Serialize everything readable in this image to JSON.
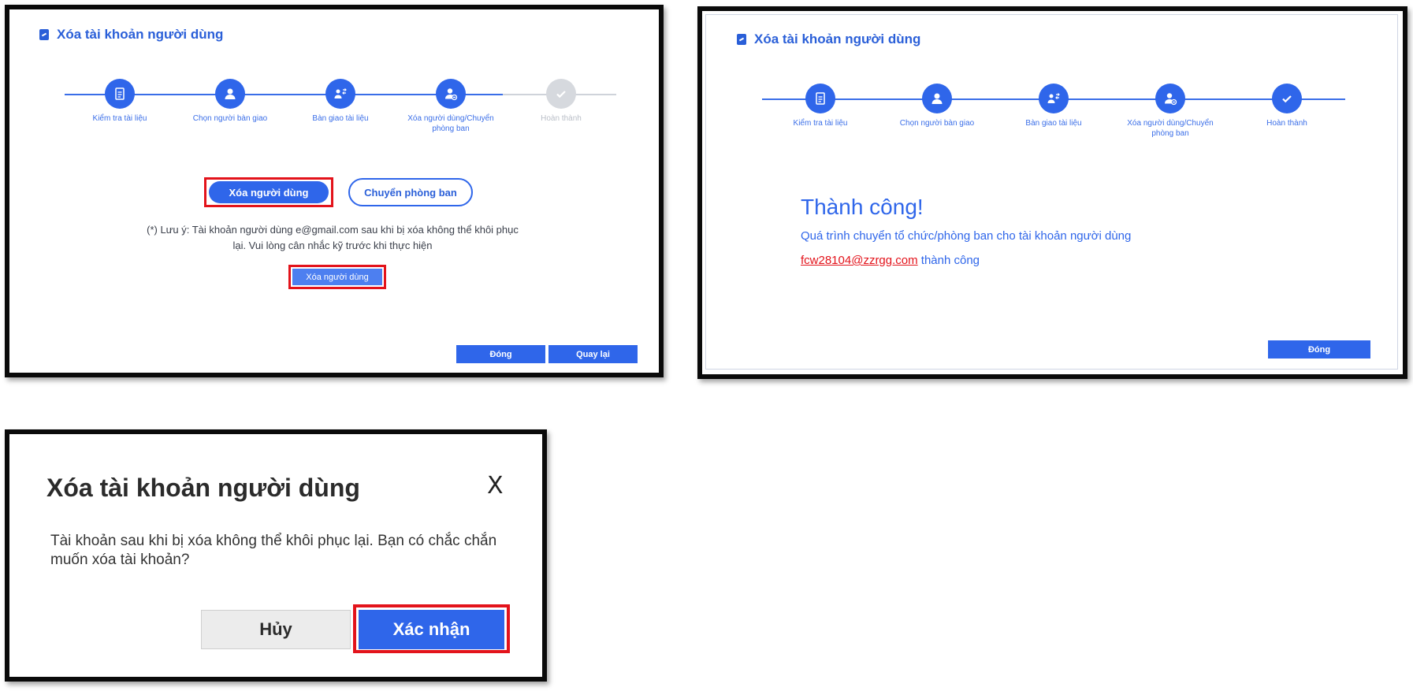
{
  "panel1": {
    "title": "Xóa tài khoản người dùng",
    "steps": [
      {
        "label": "Kiểm tra tài liệu",
        "icon": "document-icon",
        "state": "done"
      },
      {
        "label": "Chọn người bàn giao",
        "icon": "user-icon",
        "state": "done"
      },
      {
        "label": "Bàn giao tài liệu",
        "icon": "users-transfer-icon",
        "state": "done"
      },
      {
        "label": "Xóa người dùng/Chuyển phòng ban",
        "icon": "user-remove-icon",
        "state": "active"
      },
      {
        "label": "Hoàn thành",
        "icon": "check-icon",
        "state": "pending"
      }
    ],
    "delete_user_option": "Xóa người dùng",
    "transfer_department_option": "Chuyển phòng ban",
    "note_line1": "(*) Lưu ý: Tài khoản người dùng e@gmail.com sau khi bị xóa không thể khôi phục",
    "note_line2": "lại. Vui lòng cân nhắc kỹ trước khi thực hiện",
    "delete_user_button": "Xóa người dùng",
    "close_button": "Đóng",
    "back_button": "Quay lại"
  },
  "panel2": {
    "title": "Xóa tài khoản người dùng",
    "steps": [
      {
        "label": "Kiểm tra tài liệu",
        "icon": "document-icon"
      },
      {
        "label": "Chọn người bàn giao",
        "icon": "user-icon"
      },
      {
        "label": "Bàn giao tài liệu",
        "icon": "users-transfer-icon"
      },
      {
        "label": "Xóa người dùng/Chuyển phòng ban",
        "icon": "user-remove-icon"
      },
      {
        "label": "Hoàn thành",
        "icon": "check-icon"
      }
    ],
    "success_title": "Thành công!",
    "success_message": "Quá trình chuyển tổ chức/phòng ban cho tài khoản người dùng",
    "email": "fcw28104@zzrgg.com",
    "success_suffix": "thành công",
    "close_button": "Đóng"
  },
  "panel3": {
    "title": "Xóa tài khoản người dùng",
    "close_symbol": "X",
    "message": "Tài khoản sau khi bị xóa không thể khôi phục lại. Bạn có chắc chắn muốn xóa tài khoản?",
    "cancel_button": "Hủy",
    "confirm_button": "Xác nhận"
  },
  "colors": {
    "primary": "#2f66ea",
    "highlight": "#e3131b",
    "pending": "#d6d9de"
  }
}
